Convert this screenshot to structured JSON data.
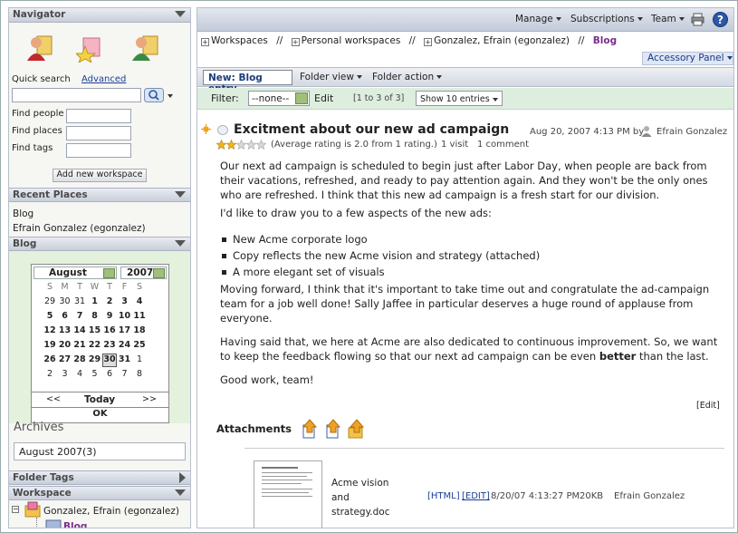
{
  "sidebar": {
    "navigator": {
      "title": "Navigator",
      "quick_search_label": "Quick search",
      "advanced_link": "Advanced",
      "find_people": "Find people",
      "find_places": "Find places",
      "find_tags": "Find tags",
      "add_workspace": "Add new workspace"
    },
    "recent_places": {
      "title": "Recent Places",
      "items": [
        "Blog",
        "Efrain Gonzalez (egonzalez)"
      ]
    },
    "blog": {
      "title": "Blog",
      "month": "August",
      "year": "2007",
      "weekdays": [
        "S",
        "M",
        "T",
        "W",
        "T",
        "F",
        "S"
      ],
      "weeks": [
        [
          "29",
          "30",
          "31",
          "1",
          "2",
          "3",
          "4"
        ],
        [
          "5",
          "6",
          "7",
          "8",
          "9",
          "10",
          "11"
        ],
        [
          "12",
          "13",
          "14",
          "15",
          "16",
          "17",
          "18"
        ],
        [
          "19",
          "20",
          "21",
          "22",
          "23",
          "24",
          "25"
        ],
        [
          "26",
          "27",
          "28",
          "29",
          "30",
          "31",
          "1"
        ],
        [
          "2",
          "3",
          "4",
          "5",
          "6",
          "7",
          "8"
        ]
      ],
      "prev": "<<",
      "today": "Today",
      "next": ">>",
      "ok": "OK",
      "archives_label": "Archives",
      "archive_item": "August 2007(3)"
    },
    "folder_tags": {
      "title": "Folder Tags"
    },
    "workspace": {
      "title": "Workspace",
      "tree_root": "Gonzalez, Efrain (egonzalez)",
      "tree_child": "Blog"
    }
  },
  "topbar": {
    "manage": "Manage",
    "subscriptions": "Subscriptions",
    "team": "Team",
    "help": "?"
  },
  "breadcrumb": {
    "items": [
      "Workspaces",
      "Personal workspaces",
      "Gonzalez, Efrain (egonzalez)"
    ],
    "sep": "//",
    "current": "Blog"
  },
  "accessory_panel": "Accessory Panel",
  "toolbar": {
    "new_entry": "New: Blog entry",
    "folder_view": "Folder view",
    "folder_action": "Folder action"
  },
  "filter": {
    "label": "Filter:",
    "value": "--none--",
    "edit": "Edit",
    "range": "[1 to 3 of 3]",
    "show": "Show 10 entries"
  },
  "entry": {
    "title": "Excitment about our new ad campaign",
    "date": "Aug 20, 2007 4:13 PM by",
    "author": "Efrain Gonzalez",
    "rating_value": 2,
    "rating_max": 5,
    "rating_text": "(Average rating is 2.0 from 1 rating.)",
    "visits": "1 visit",
    "comments": "1 comment",
    "p1": "Our next ad campaign is scheduled to begin just after Labor Day, when people are back from their vacations, refreshed, and ready to pay attention again. And they won't be the only ones who are refreshed. I think that this new ad campaign is a fresh start for our division.",
    "p2": "I'd like to draw you to a few aspects of the new ads:",
    "bullets": [
      "New Acme corporate logo",
      "Copy reflects the new Acme vision and strategy (attached)",
      "A more elegant set of visuals"
    ],
    "p3": "Moving forward, I think that it's important to take time out and congratulate the ad-campaign team for a job well done! Sally Jaffee in particular deserves a huge round of applause from everyone.",
    "p4_before": "Having said that, we here at Acme are also dedicated to continuous improvement. So, we want to keep the feedback flowing so that our next ad campaign can be even ",
    "p4_bold": "better",
    "p4_after": " than the last.",
    "p5": "Good work, team!",
    "edit_link": "[Edit]"
  },
  "attachments": {
    "title": "Attachments",
    "file_name_lines": [
      "Acme vision",
      "and",
      "strategy.doc"
    ],
    "html_link": "[HTML]",
    "edit_link": "[EDIT]",
    "date": "8/20/07 4:13:27 PM",
    "size": "20KB",
    "owner": "Efrain Gonzalez"
  }
}
